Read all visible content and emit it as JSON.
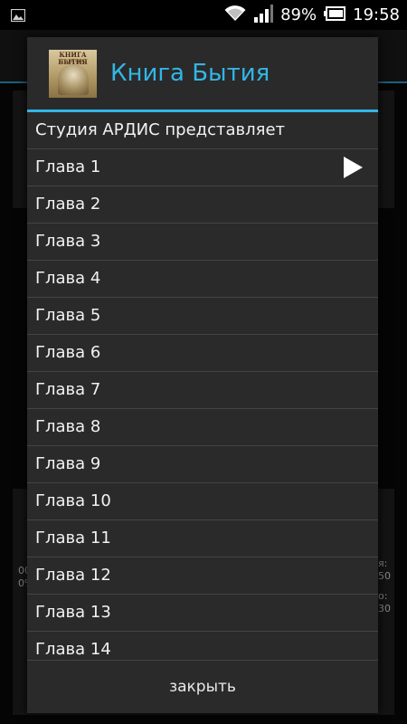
{
  "status_bar": {
    "battery_percent": "89%",
    "time": "19:58",
    "icons": [
      "gallery-notification-icon",
      "wifi-icon",
      "signal-icon",
      "battery-icon"
    ]
  },
  "background": {
    "left_fragments": [
      "00",
      "0%"
    ],
    "right_fragments": [
      "я:",
      "50",
      "о:",
      "30"
    ]
  },
  "dialog": {
    "title": "Книга Бытия",
    "cover": {
      "title": "КНИГА БЫТИЯ",
      "subtitle": "ВЕТХИЙ ЗАВЕТ"
    },
    "items": [
      {
        "label": "Студия АРДИС представляет"
      },
      {
        "label": "Глава 1",
        "playing": true
      },
      {
        "label": "Глава 2"
      },
      {
        "label": "Глава 3"
      },
      {
        "label": "Глава 4"
      },
      {
        "label": "Глава 5"
      },
      {
        "label": "Глава 6"
      },
      {
        "label": "Глава 7"
      },
      {
        "label": "Глава 8"
      },
      {
        "label": "Глава 9"
      },
      {
        "label": "Глава 10"
      },
      {
        "label": "Глава 11"
      },
      {
        "label": "Глава 12"
      },
      {
        "label": "Глава 13"
      },
      {
        "label": "Глава 14"
      }
    ],
    "close_label": "закрыть"
  },
  "colors": {
    "accent": "#33b5e5",
    "dialog_bg": "#2a2a2a",
    "divider": "#444444"
  }
}
